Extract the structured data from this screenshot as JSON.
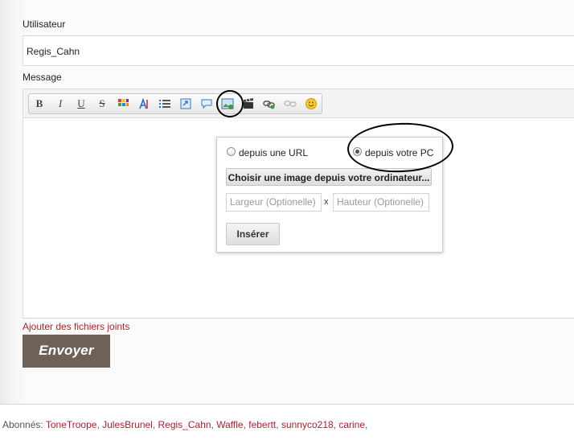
{
  "form": {
    "user_label": "Utilisateur",
    "user_value": "Regis_Cahn",
    "message_label": "Message"
  },
  "toolbar": {
    "buttons": [
      {
        "name": "bold",
        "glyph": "B"
      },
      {
        "name": "italic",
        "glyph": "I"
      },
      {
        "name": "underline",
        "glyph": "U"
      },
      {
        "name": "strikethrough",
        "glyph": "S"
      },
      {
        "name": "color",
        "icon": "color-palette-icon"
      },
      {
        "name": "font-size",
        "icon": "text-size-icon"
      },
      {
        "name": "list",
        "icon": "list-icon"
      },
      {
        "name": "link-page",
        "icon": "link-page-icon"
      },
      {
        "name": "quote",
        "icon": "speech-bubble-icon"
      },
      {
        "name": "image",
        "icon": "image-icon"
      },
      {
        "name": "video",
        "icon": "clapperboard-icon"
      },
      {
        "name": "link",
        "icon": "link-icon"
      },
      {
        "name": "unlink",
        "icon": "unlink-icon"
      },
      {
        "name": "emoji",
        "icon": "smiley-icon"
      }
    ]
  },
  "image_popup": {
    "option_url": "depuis une URL",
    "option_pc": "depuis votre PC",
    "selected": "pc",
    "choose_button": "Choisir une image depuis votre ordinateur...",
    "width_placeholder": "Largeur (Optionelle)",
    "separator": "x",
    "height_placeholder": "Hauteur (Optionelle)",
    "insert_button": "Insérer"
  },
  "attach_link": "Ajouter des fichiers joints",
  "send_button": "Envoyer",
  "subscribers": {
    "label": "Abonnés:",
    "names": [
      "ToneTroope",
      "JulesBrunel",
      "Regis_Cahn",
      "Waffle",
      "febertt",
      "sunnyco218",
      "carine"
    ]
  },
  "colors": {
    "link_red": "#b2202b",
    "send_bg": "#6e6258"
  }
}
